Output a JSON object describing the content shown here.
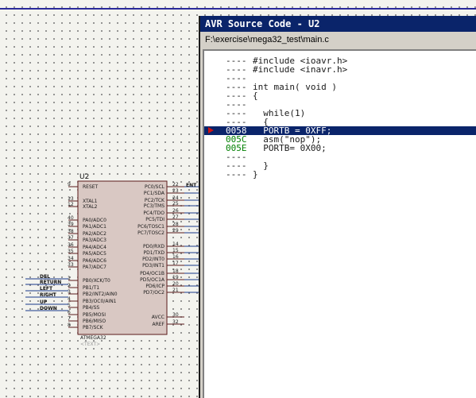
{
  "window": {
    "title": "AVR Source Code - U2",
    "path": "F:\\exercise\\mega32_test\\main.c"
  },
  "code_lines": [
    {
      "addr": "----",
      "code": "#include <ioavr.h>"
    },
    {
      "addr": "----",
      "code": "#include <inavr.h>"
    },
    {
      "addr": "----",
      "code": ""
    },
    {
      "addr": "----",
      "code": "int main( void )"
    },
    {
      "addr": "----",
      "code": "{"
    },
    {
      "addr": "----",
      "code": ""
    },
    {
      "addr": "----",
      "code": "  while(1)"
    },
    {
      "addr": "----",
      "code": "  {"
    },
    {
      "addr": "0058",
      "code": "  PORTB = 0XFF;",
      "highlight": true,
      "breakpoint": true
    },
    {
      "addr": "005C",
      "code": "  asm(\"nop\");"
    },
    {
      "addr": "005E",
      "code": "  PORTB= 0X00;"
    },
    {
      "addr": "----",
      "code": ""
    },
    {
      "addr": "----",
      "code": "  }"
    },
    {
      "addr": "----",
      "code": "}"
    }
  ],
  "schematic": {
    "ref": "U2",
    "part": "ATMEGA32",
    "text_label": "<TEXT>",
    "left_pins": [
      {
        "num": "9",
        "name": "RESET"
      },
      {
        "num": "13",
        "name": "XTAL1"
      },
      {
        "num": "12",
        "name": "XTAL2"
      },
      {
        "num": "40",
        "name": "PA0/ADC0"
      },
      {
        "num": "39",
        "name": "PA1/ADC1"
      },
      {
        "num": "38",
        "name": "PA2/ADC2"
      },
      {
        "num": "37",
        "name": "PA3/ADC3"
      },
      {
        "num": "36",
        "name": "PA4/ADC4"
      },
      {
        "num": "35",
        "name": "PA5/ADC5"
      },
      {
        "num": "34",
        "name": "PA6/ADC6"
      },
      {
        "num": "33",
        "name": "PA7/ADC7"
      },
      {
        "num": "1",
        "name": "PB0/XCK/T0"
      },
      {
        "num": "2",
        "name": "PB1/T1"
      },
      {
        "num": "3",
        "name": "PB2/INT2/AIN0"
      },
      {
        "num": "4",
        "name": "PB3/OC0/AIN1"
      },
      {
        "num": "5",
        "name": "PB4/SS"
      },
      {
        "num": "6",
        "name": "PB5/MOSI"
      },
      {
        "num": "7",
        "name": "PB6/MISO"
      },
      {
        "num": "8",
        "name": "PB7/SCK"
      }
    ],
    "right_pins": [
      {
        "num": "22",
        "name": "PC0/SCL"
      },
      {
        "num": "23",
        "name": "PC1/SDA"
      },
      {
        "num": "24",
        "name": "PC2/TCK"
      },
      {
        "num": "25",
        "name": "PC3/TMS"
      },
      {
        "num": "26",
        "name": "PC4/TDO"
      },
      {
        "num": "27",
        "name": "PC5/TDI"
      },
      {
        "num": "28",
        "name": "PC6/TOSC1"
      },
      {
        "num": "29",
        "name": "PC7/TOSC2"
      },
      {
        "num": "14",
        "name": "PD0/RXD"
      },
      {
        "num": "15",
        "name": "PD1/TXD"
      },
      {
        "num": "16",
        "name": "PD2/INT0"
      },
      {
        "num": "17",
        "name": "PD3/INT1"
      },
      {
        "num": "18",
        "name": "PD4/OC1B"
      },
      {
        "num": "19",
        "name": "PD5/OC1A"
      },
      {
        "num": "20",
        "name": "PD6/ICP"
      },
      {
        "num": "21",
        "name": "PD7/OC2"
      },
      {
        "num": "30",
        "name": "AVCC"
      },
      {
        "num": "32",
        "name": "AREF"
      }
    ],
    "net_labels": [
      "DEL",
      "RETURN",
      "LEFT",
      "RIGHT",
      "UP",
      "DOWN"
    ],
    "right_edge_label": "ENT"
  }
}
